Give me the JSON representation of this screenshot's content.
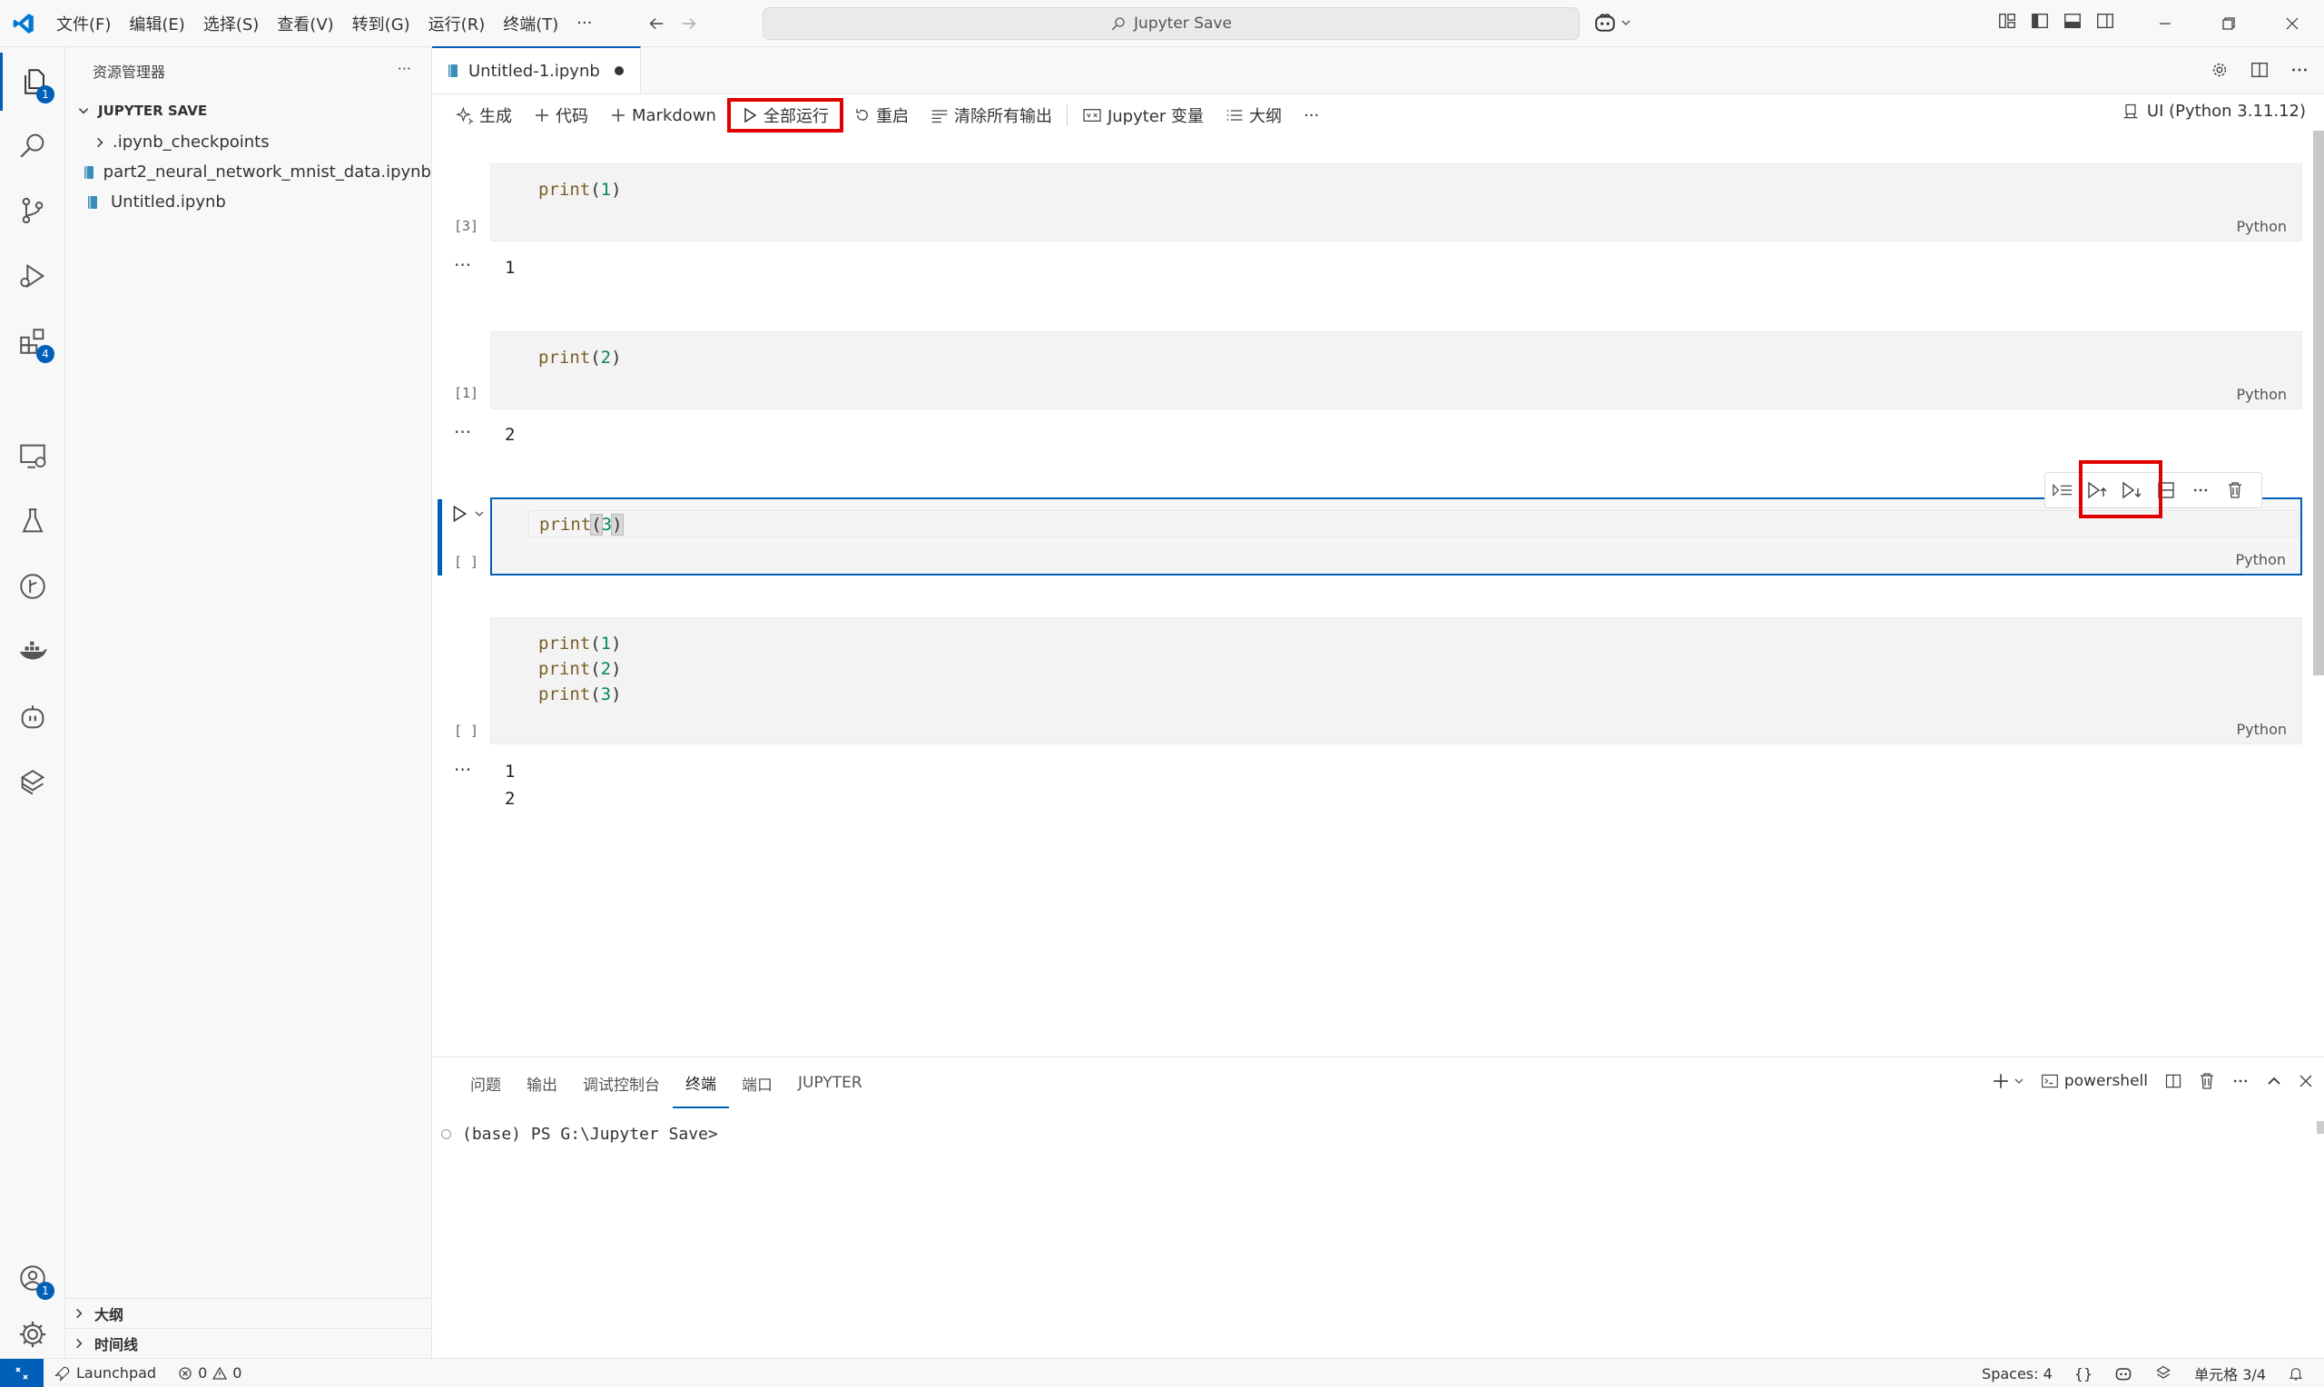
{
  "titlebar": {
    "menus": [
      "文件(F)",
      "编辑(E)",
      "选择(S)",
      "查看(V)",
      "转到(G)",
      "运行(R)",
      "终端(T)"
    ],
    "more": "···",
    "search_text": "Jupyter Save"
  },
  "activity": {
    "explorer_badge": "1",
    "extensions_badge": "4",
    "accounts_badge": "1"
  },
  "sidebar": {
    "title": "资源管理器",
    "more": "···",
    "folder": "JUPYTER SAVE",
    "items": [
      {
        "label": ".ipynb_checkpoints"
      },
      {
        "label": "part2_neural_network_mnist_data.ipynb"
      },
      {
        "label": "Untitled.ipynb"
      }
    ],
    "outline": "大纲",
    "timeline": "时间线"
  },
  "editor": {
    "tab_label": "Untitled-1.ipynb",
    "toolbar": {
      "generate": "生成",
      "code": "代码",
      "markdown": "Markdown",
      "run_all": "全部运行",
      "restart": "重启",
      "clear_outputs": "清除所有输出",
      "variables": "Jupyter 变量",
      "outline": "大纲",
      "more": "···",
      "kernel": "UI (Python 3.11.12)"
    },
    "cells": [
      {
        "count": "[3]",
        "fn": "print",
        "arg": "1",
        "lang": "Python",
        "output": "1"
      },
      {
        "count": "[1]",
        "fn": "print",
        "arg": "2",
        "lang": "Python",
        "output": "2"
      },
      {
        "count": "[ ]",
        "fn": "print",
        "arg": "3",
        "lang": "Python"
      },
      {
        "count": "[ ]",
        "lang": "Python",
        "lines": [
          {
            "fn": "print",
            "arg": "1"
          },
          {
            "fn": "print",
            "arg": "2"
          },
          {
            "fn": "print",
            "arg": "3"
          }
        ],
        "output": [
          "1",
          "2"
        ]
      }
    ],
    "output_dots": "···"
  },
  "panel": {
    "tabs": [
      "问题",
      "输出",
      "调试控制台",
      "终端",
      "端口",
      "JUPYTER"
    ],
    "active_tab": "终端",
    "shell": "powershell",
    "prompt": "(base) PS G:\\Jupyter Save>"
  },
  "statusbar": {
    "launchpad": "Launchpad",
    "errors": "0",
    "warnings": "0",
    "spaces": "Spaces: 4",
    "braces": "{}",
    "cell": "单元格 3/4"
  },
  "colors": {
    "accent": "#005fb8",
    "highlight_box": "#e00000"
  }
}
